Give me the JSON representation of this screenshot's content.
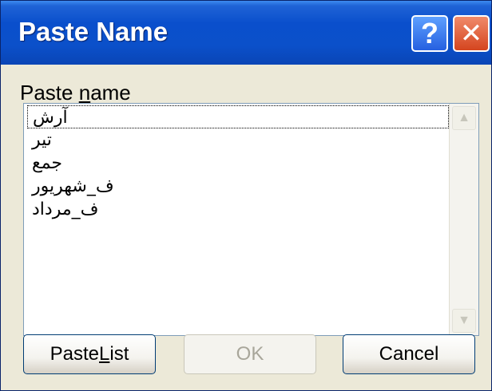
{
  "window": {
    "title": "Paste Name",
    "help_glyph": "?",
    "close_glyph": "✕"
  },
  "paste_name": {
    "label_prefix": "Paste ",
    "label_accel": "n",
    "label_suffix": "ame",
    "items": [
      {
        "label": "آرش",
        "focused": true
      },
      {
        "label": "تیر",
        "focused": false
      },
      {
        "label": "جمع",
        "focused": false
      },
      {
        "label": "ف_شهریور",
        "focused": false
      },
      {
        "label": "ف_مرداد",
        "focused": false
      }
    ]
  },
  "scrollbar": {
    "up_glyph": "▲",
    "down_glyph": "▼"
  },
  "buttons": {
    "paste_list_prefix": "Paste ",
    "paste_list_accel": "L",
    "paste_list_suffix": "ist",
    "ok": "OK",
    "ok_enabled": false,
    "cancel": "Cancel"
  },
  "colors": {
    "title_bar": "#0a4fcc",
    "dialog_bg": "#ece9d8",
    "close_button": "#d4451f",
    "help_button": "#2660e0"
  }
}
